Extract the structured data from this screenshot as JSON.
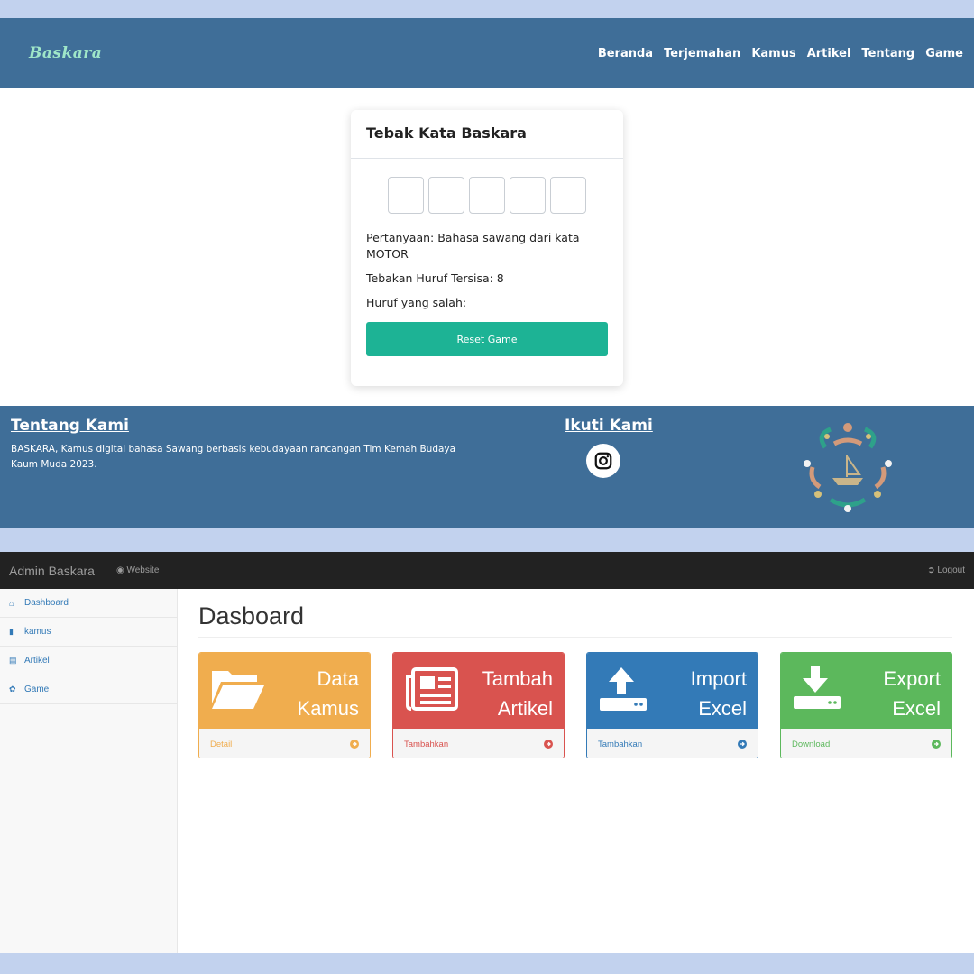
{
  "colors": {
    "page_background": "#c2d2ee",
    "site_nav": "#3f6e98",
    "reset_button": "#1db395",
    "admin_bar": "#222222",
    "panel_orange": "#f0ad4e",
    "panel_red": "#d9534f",
    "panel_blue": "#337ab7",
    "panel_green": "#5cb85c"
  },
  "site": {
    "logo": "Baskara",
    "nav": [
      "Beranda",
      "Terjemahan",
      "Kamus",
      "Artikel",
      "Tentang",
      "Game"
    ],
    "game": {
      "title": "Tebak Kata Baskara",
      "question": "Pertanyaan: Bahasa sawang dari kata MOTOR",
      "remaining": "Tebakan Huruf Tersisa: 8",
      "wrong": "Huruf yang salah:",
      "reset_label": "Reset Game"
    },
    "footer": {
      "about_title": "Tentang Kami",
      "about_text": "BASKARA, Kamus digital bahasa Sawang berbasis kebudayaan rancangan Tim Kemah Budaya Kaum Muda 2023.",
      "follow_title": "Ikuti Kami",
      "social_icon": "instagram-icon"
    }
  },
  "admin": {
    "brand": "Admin Baskara",
    "website_link": "Website",
    "logout": "Logout",
    "sidebar": [
      {
        "label": "Dashboard",
        "icon": "home-icon"
      },
      {
        "label": "kamus",
        "icon": "book-icon"
      },
      {
        "label": "Artikel",
        "icon": "newspaper-icon"
      },
      {
        "label": "Game",
        "icon": "leaf-icon"
      }
    ],
    "page_title": "Dasboard",
    "panels": [
      {
        "line1": "Data",
        "line2": "Kamus",
        "footer": "Detail",
        "icon": "folder-open-icon"
      },
      {
        "line1": "Tambah",
        "line2": "Artikel",
        "footer": "Tambahkan",
        "icon": "newspaper-icon"
      },
      {
        "line1": "Import",
        "line2": "Excel",
        "footer": "Tambahkan",
        "icon": "upload-icon"
      },
      {
        "line1": "Export",
        "line2": "Excel",
        "footer": "Download",
        "icon": "download-icon"
      }
    ]
  }
}
